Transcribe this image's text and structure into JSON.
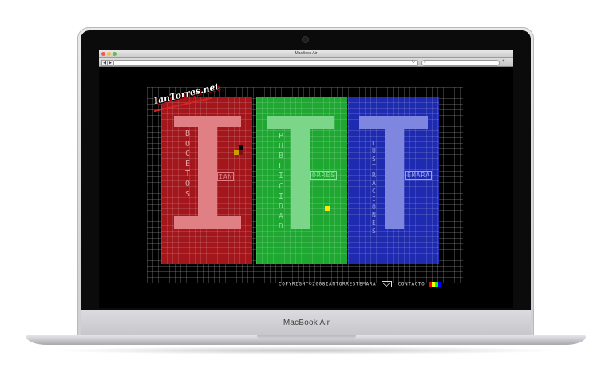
{
  "device": {
    "model_label": "MacBook Air"
  },
  "browser": {
    "window_title": "MacBook Air",
    "url": "",
    "search_placeholder": "",
    "back_label": "◀",
    "forward_label": "▶",
    "search_icon": "search-icon",
    "new_tab_label": "+"
  },
  "site": {
    "logo_text": "IanTorres.net",
    "panels": [
      {
        "id": "red",
        "color": "#a3161c",
        "big_letter": "I",
        "vertical_word": "BOCETOS",
        "horizontal_word": "IAN"
      },
      {
        "id": "green",
        "color": "#1fa831",
        "big_letter": "T",
        "vertical_word": "PUBLICIDAD",
        "horizontal_word": "ORRES"
      },
      {
        "id": "blue",
        "color": "#1e2bb0",
        "big_letter": "T",
        "vertical_word": "ILUSTRACIONES",
        "horizontal_word": "EMARA"
      }
    ],
    "footer": {
      "copyright": "COPYRIGHT©2008IANTORRESTEMARA",
      "contact_label": "CONTACTO",
      "color_dots": [
        "#ff0000",
        "#ffff00",
        "#00ff00",
        "#0000ff"
      ]
    }
  },
  "colors": {
    "accent_yellow": "#ffe800",
    "letter_red": "#e07f84",
    "letter_green": "#7cd68a",
    "letter_blue": "#7f86e0"
  }
}
